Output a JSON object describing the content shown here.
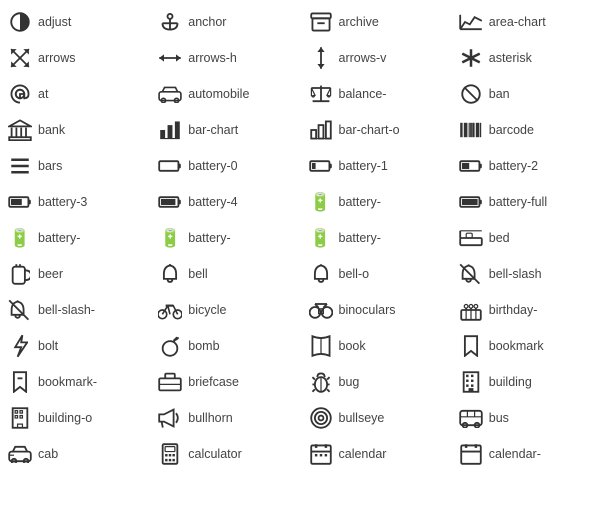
{
  "icons": [
    {
      "label": "adjust",
      "symbol": "◐"
    },
    {
      "label": "anchor",
      "symbol": "⚓"
    },
    {
      "label": "archive",
      "symbol": "🗄"
    },
    {
      "label": "area-chart",
      "symbol": "📈"
    },
    {
      "label": "arrows",
      "symbol": "⤡"
    },
    {
      "label": "arrows-h",
      "symbol": "↔"
    },
    {
      "label": "arrows-v",
      "symbol": "↕"
    },
    {
      "label": "asterisk",
      "symbol": "✳"
    },
    {
      "label": "at",
      "symbol": "@"
    },
    {
      "label": "automobile",
      "symbol": "🚗"
    },
    {
      "label": "balance-",
      "symbol": "⚖"
    },
    {
      "label": "ban",
      "symbol": "🚫"
    },
    {
      "label": "bank",
      "symbol": "🏛"
    },
    {
      "label": "bar-chart",
      "symbol": "📊"
    },
    {
      "label": "bar-chart-o",
      "symbol": "📉"
    },
    {
      "label": "barcode",
      "symbol": "▌▐▌"
    },
    {
      "label": "bars",
      "symbol": "≡"
    },
    {
      "label": "battery-0",
      "symbol": "🔋"
    },
    {
      "label": "battery-1",
      "symbol": "🔋"
    },
    {
      "label": "battery-2",
      "symbol": "🔋"
    },
    {
      "label": "battery-3",
      "symbol": "🔋"
    },
    {
      "label": "battery-4",
      "symbol": "🔋"
    },
    {
      "label": "battery-",
      "symbol": "🔋"
    },
    {
      "label": "battery-full",
      "symbol": "🔋"
    },
    {
      "label": "battery-",
      "symbol": "🔋"
    },
    {
      "label": "battery-",
      "symbol": "🔋"
    },
    {
      "label": "battery-",
      "symbol": "🔋"
    },
    {
      "label": "bed",
      "symbol": "🛏"
    },
    {
      "label": "beer",
      "symbol": "🍺"
    },
    {
      "label": "bell",
      "symbol": "🔔"
    },
    {
      "label": "bell-o",
      "symbol": "🔔"
    },
    {
      "label": "bell-slash",
      "symbol": "🔕"
    },
    {
      "label": "bell-slash-",
      "symbol": "🔕"
    },
    {
      "label": "bicycle",
      "symbol": "🚲"
    },
    {
      "label": "binoculars",
      "symbol": "🔭"
    },
    {
      "label": "birthday-",
      "symbol": "🎂"
    },
    {
      "label": "bolt",
      "symbol": "⚡"
    },
    {
      "label": "bomb",
      "symbol": "💣"
    },
    {
      "label": "book",
      "symbol": "📖"
    },
    {
      "label": "bookmark",
      "symbol": "🔖"
    },
    {
      "label": "bookmark-",
      "symbol": "🔖"
    },
    {
      "label": "briefcase",
      "symbol": "💼"
    },
    {
      "label": "bug",
      "symbol": "🐛"
    },
    {
      "label": "building",
      "symbol": "🏢"
    },
    {
      "label": "building-o",
      "symbol": "🏢"
    },
    {
      "label": "bullhorn",
      "symbol": "📢"
    },
    {
      "label": "bullseye",
      "symbol": "🎯"
    },
    {
      "label": "bus",
      "symbol": "🚌"
    },
    {
      "label": "cab",
      "symbol": "🚕"
    },
    {
      "label": "calculator",
      "symbol": "🧮"
    },
    {
      "label": "calendar",
      "symbol": "📅"
    },
    {
      "label": "calendar-",
      "symbol": "📅"
    }
  ]
}
